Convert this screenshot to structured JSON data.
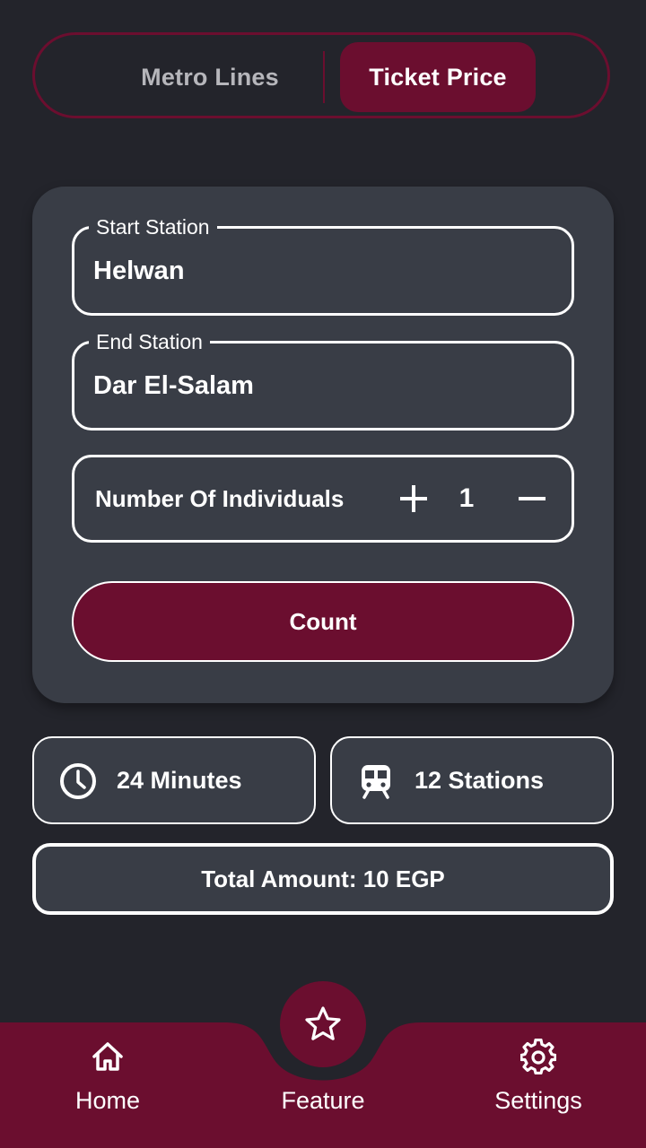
{
  "tabs": {
    "metro_lines": "Metro Lines",
    "ticket_price": "Ticket Price",
    "active": "ticket_price"
  },
  "form": {
    "start_station": {
      "label": "Start Station",
      "value": "Helwan"
    },
    "end_station": {
      "label": "End Station",
      "value": "Dar El-Salam"
    },
    "individuals": {
      "label": "Number Of Individuals",
      "value": "1"
    },
    "count_button": "Count"
  },
  "results": {
    "duration": "24 Minutes",
    "stations": "12 Stations",
    "total": "Total Amount: 10 EGP"
  },
  "bottom_nav": {
    "home": "Home",
    "feature": "Feature",
    "settings": "Settings"
  },
  "icons": {
    "duration": "clock-icon",
    "stations": "train-icon",
    "increment": "plus-icon",
    "decrement": "minus-icon",
    "home": "home-icon",
    "feature": "star-icon",
    "settings": "gear-icon"
  },
  "colors": {
    "background": "#23242b",
    "card": "#393d46",
    "accent": "#6b0e2f",
    "text": "#ffffff",
    "inactive_tab_text": "#b6b6bb"
  }
}
